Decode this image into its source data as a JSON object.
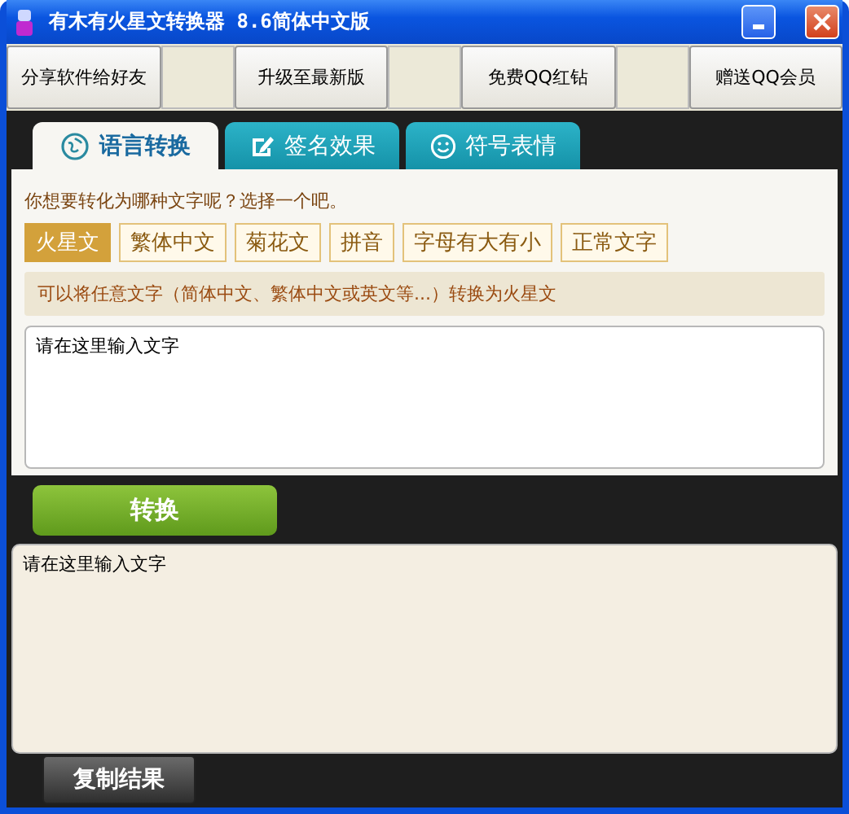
{
  "window": {
    "title": "有木有火星文转换器 8.6简体中文版"
  },
  "toolbar": [
    {
      "label": "分享软件给好友"
    },
    {
      "label": "升级至最新版"
    },
    {
      "label": "免费QQ红钻"
    },
    {
      "label": "赠送QQ会员"
    }
  ],
  "tabs": [
    {
      "label": "语言转换",
      "kind": "globe",
      "selected": true
    },
    {
      "label": "签名效果",
      "kind": "pen",
      "selected": false
    },
    {
      "label": "符号表情",
      "kind": "smiley",
      "selected": false
    }
  ],
  "question": "你想要转化为哪种文字呢？选择一个吧。",
  "options": [
    {
      "label": "火星文",
      "selected": true
    },
    {
      "label": "繁体中文",
      "selected": false
    },
    {
      "label": "菊花文",
      "selected": false
    },
    {
      "label": "拼音",
      "selected": false
    },
    {
      "label": "字母有大有小",
      "selected": false
    },
    {
      "label": "正常文字",
      "selected": false
    }
  ],
  "hint": "可以将任意文字（简体中文、繁体中文或英文等...）转换为火星文",
  "input": {
    "value": "请在这里输入文字"
  },
  "convert_button": "转换",
  "output": {
    "value": "请在这里输入文字"
  },
  "copy_button": "复制结果"
}
